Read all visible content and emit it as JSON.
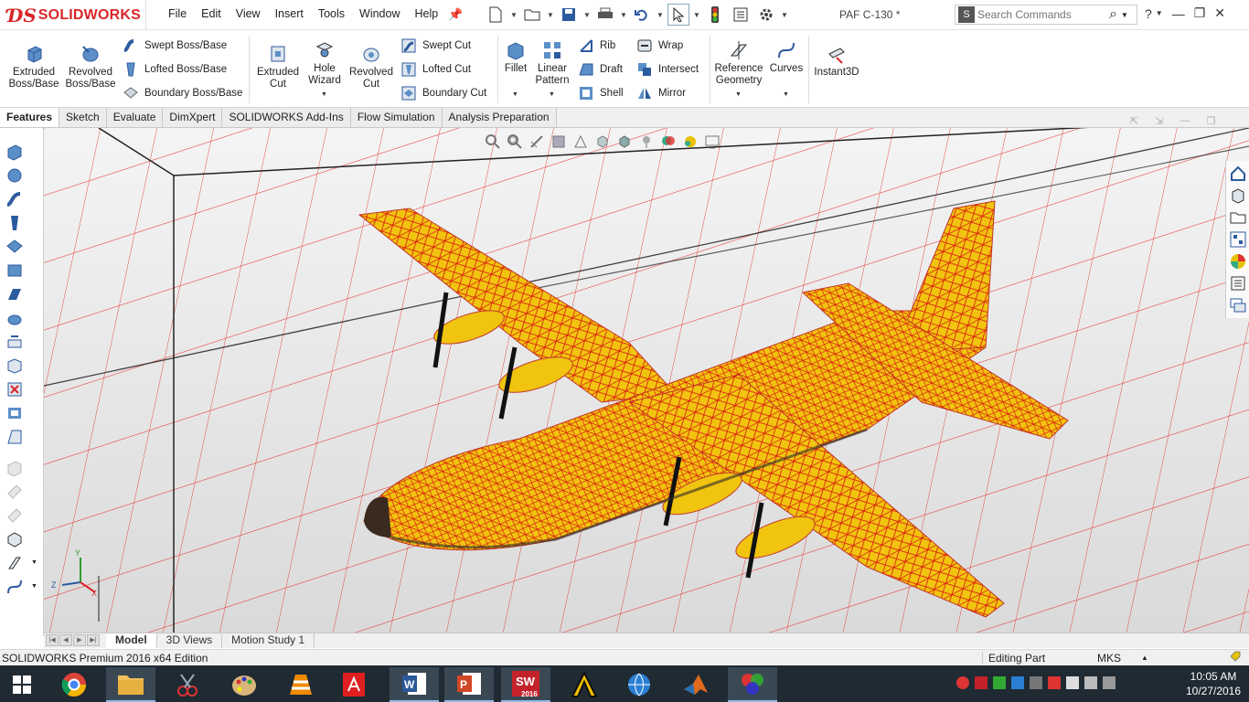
{
  "app": {
    "brand": "SOLIDWORKS",
    "document_title": "PAF C-130 *"
  },
  "menu": [
    "File",
    "Edit",
    "View",
    "Insert",
    "Tools",
    "Window",
    "Help"
  ],
  "search": {
    "placeholder": "Search Commands"
  },
  "ribbon": {
    "extruded_boss": "Extruded Boss/Base",
    "revolved_boss": "Revolved Boss/Base",
    "swept_boss": "Swept Boss/Base",
    "lofted_boss": "Lofted Boss/Base",
    "boundary_boss": "Boundary Boss/Base",
    "extruded_cut": "Extruded Cut",
    "hole_wizard": "Hole Wizard",
    "revolved_cut": "Revolved Cut",
    "swept_cut": "Swept Cut",
    "lofted_cut": "Lofted Cut",
    "boundary_cut": "Boundary Cut",
    "fillet": "Fillet",
    "linear_pattern": "Linear Pattern",
    "rib": "Rib",
    "draft": "Draft",
    "shell": "Shell",
    "wrap": "Wrap",
    "intersect": "Intersect",
    "mirror": "Mirror",
    "reference_geometry": "Reference Geometry",
    "curves": "Curves",
    "instant3d": "Instant3D"
  },
  "tabs": [
    "Features",
    "Sketch",
    "Evaluate",
    "DimXpert",
    "SOLIDWORKS Add-Ins",
    "Flow Simulation",
    "Analysis Preparation"
  ],
  "bottom_tabs": [
    "Model",
    "3D Views",
    "Motion Study 1"
  ],
  "status": {
    "edition": "SOLIDWORKS Premium 2016 x64 Edition",
    "mode": "Editing Part",
    "units": "MKS"
  },
  "clock": {
    "time": "10:05 AM",
    "date": "10/27/2016"
  },
  "taskbar": {
    "sw_badge": "2016"
  },
  "colors": {
    "brand_red": "#d9262a",
    "mesh_red": "#e4201a",
    "model_yellow": "#f1c40f",
    "viewport_bg": "#e6e6e6"
  }
}
